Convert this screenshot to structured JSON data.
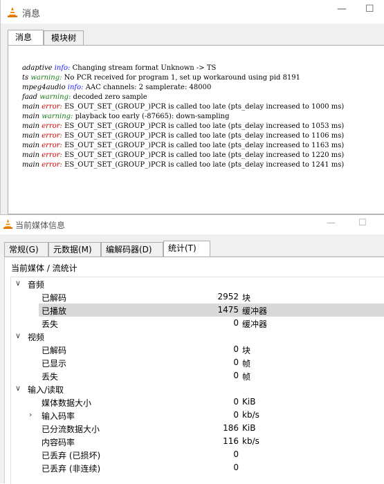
{
  "messages_window": {
    "title": "消息",
    "controls": {
      "minimize": "—",
      "maximize": "☐"
    },
    "tabs": [
      {
        "label": "消息",
        "active": true
      },
      {
        "label": "模块树",
        "active": false
      }
    ],
    "log": [
      {
        "source": "adaptive",
        "level": "info",
        "text": "Changing stream format Unknown -> TS"
      },
      {
        "source": "ts",
        "level": "warning",
        "text": "No PCR received for program 1, set up workaround using pid 8191"
      },
      {
        "source": "mpeg4audio",
        "level": "info",
        "text": "AAC channels: 2 samplerate: 48000"
      },
      {
        "source": "faad",
        "level": "warning",
        "text": "decoded zero sample"
      },
      {
        "source": "main",
        "level": "error",
        "text": "ES_OUT_SET_(GROUP_)PCR is called too late (pts_delay increased to 1000 ms)"
      },
      {
        "source": "main",
        "level": "warning",
        "text": "playback too early (-87665): down-sampling"
      },
      {
        "source": "main",
        "level": "error",
        "text": "ES_OUT_SET_(GROUP_)PCR is called too late (pts_delay increased to 1053 ms)"
      },
      {
        "source": "main",
        "level": "error",
        "text": "ES_OUT_SET_(GROUP_)PCR is called too late (pts_delay increased to 1106 ms)"
      },
      {
        "source": "main",
        "level": "error",
        "text": "ES_OUT_SET_(GROUP_)PCR is called too late (pts_delay increased to 1163 ms)"
      },
      {
        "source": "main",
        "level": "error",
        "text": "ES_OUT_SET_(GROUP_)PCR is called too late (pts_delay increased to 1220 ms)"
      },
      {
        "source": "main",
        "level": "error",
        "text": "ES_OUT_SET_(GROUP_)PCR is called too late (pts_delay increased to 1241 ms)"
      }
    ]
  },
  "media_info_window": {
    "title": "当前媒体信息",
    "controls": {
      "minimize": "—",
      "maximize": "☐"
    },
    "tabs": [
      {
        "label": "常规(G)",
        "active": false
      },
      {
        "label": "元数据(M)",
        "active": false
      },
      {
        "label": "编解码器(D)",
        "active": false
      },
      {
        "label": "统计(T)",
        "active": true
      }
    ],
    "breadcrumb": "当前媒体 / 流统计",
    "groups": [
      {
        "label": "音频",
        "expanded": true,
        "items": [
          {
            "label": "已解码",
            "value": "2952",
            "unit": "块"
          },
          {
            "label": "已播放",
            "value": "1475",
            "unit": "缓冲器",
            "selected": true
          },
          {
            "label": "丢失",
            "value": "0",
            "unit": "缓冲器"
          }
        ]
      },
      {
        "label": "视频",
        "expanded": true,
        "items": [
          {
            "label": "已解码",
            "value": "0",
            "unit": "块"
          },
          {
            "label": "已显示",
            "value": "0",
            "unit": "帧"
          },
          {
            "label": "丢失",
            "value": "0",
            "unit": "帧"
          }
        ]
      },
      {
        "label": "输入/读取",
        "expanded": true,
        "items": [
          {
            "label": "媒体数据大小",
            "value": "0",
            "unit": "KiB"
          },
          {
            "label": "输入码率",
            "value": "0",
            "unit": "kb/s",
            "collapsed_child": true
          },
          {
            "label": "已分流数据大小",
            "value": "186",
            "unit": "KiB"
          },
          {
            "label": "内容码率",
            "value": "116",
            "unit": "kb/s"
          },
          {
            "label": "已丢弃 (已损坏)",
            "value": "0",
            "unit": ""
          },
          {
            "label": "已丢弃 (非连续)",
            "value": "0",
            "unit": ""
          }
        ]
      }
    ]
  },
  "colors": {
    "info": "#1818ff",
    "warning": "#1a7a1a",
    "error": "#d00000",
    "selection": "#d9d9d9"
  },
  "icons": {
    "app": "vlc-cone-icon",
    "expand": "chevron-down-icon",
    "collapse": "chevron-right-icon"
  }
}
